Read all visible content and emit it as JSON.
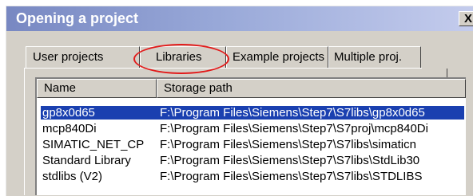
{
  "dialog": {
    "title": "Opening a project",
    "close_label": "X"
  },
  "tabs": [
    {
      "label": "User projects",
      "active": false
    },
    {
      "label": "Libraries",
      "active": true
    },
    {
      "label": "Example projects",
      "active": false
    },
    {
      "label": "Multiple proj.",
      "active": false
    }
  ],
  "highlight_color": "#e21a1a",
  "selection_color": "#1a40b0",
  "list": {
    "columns": [
      "Name",
      "Storage path"
    ],
    "rows": [
      {
        "name": "gp8x0d65",
        "path": "F:\\Program Files\\Siemens\\Step7\\S7libs\\gp8x0d65",
        "selected": true
      },
      {
        "name": "mcp840Di",
        "path": "F:\\Program Files\\Siemens\\Step7\\S7proj\\mcp840Di",
        "selected": false
      },
      {
        "name": "SIMATIC_NET_CP",
        "path": "F:\\Program Files\\Siemens\\Step7\\S7libs\\simaticn",
        "selected": false
      },
      {
        "name": "Standard Library",
        "path": "F:\\Program  Files\\Siemens\\Step7\\S7libs\\StdLib30",
        "selected": false
      },
      {
        "name": "stdlibs (V2)",
        "path": "F:\\Program Files\\Siemens\\Step7\\S7libs\\STDLIBS",
        "selected": false
      }
    ]
  }
}
